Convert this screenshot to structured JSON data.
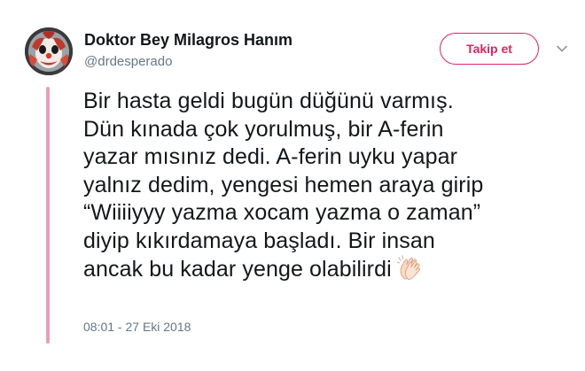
{
  "user": {
    "display_name": "Doktor Bey Milagros Hanım",
    "handle": "@drdesperado",
    "avatar_icon": "clown-face-avatar"
  },
  "actions": {
    "follow_label": "Takip et",
    "menu_icon": "chevron-down-icon"
  },
  "tweet": {
    "lines": [
      "Bir hasta geldi bugün düğünü varmış.",
      "Dün kınada çok yorulmuş, bir A-ferin",
      "yazar mısınız dedi. A-ferin uyku yapar",
      "yalnız dedim, yengesi hemen araya girip",
      "“Wiiiiyyy yazma xocam yazma o zaman”",
      "diyip kıkırdamaya başladı. Bir insan",
      "ancak bu kadar yenge olabilirdi"
    ],
    "emoji": "clapping-hands-icon",
    "timestamp": "08:01 - 27 Eki 2018"
  },
  "colors": {
    "accent": "#e0245e",
    "thread_line": "#e8a0b4",
    "secondary_text": "#657786",
    "primary_text": "#14171a"
  }
}
